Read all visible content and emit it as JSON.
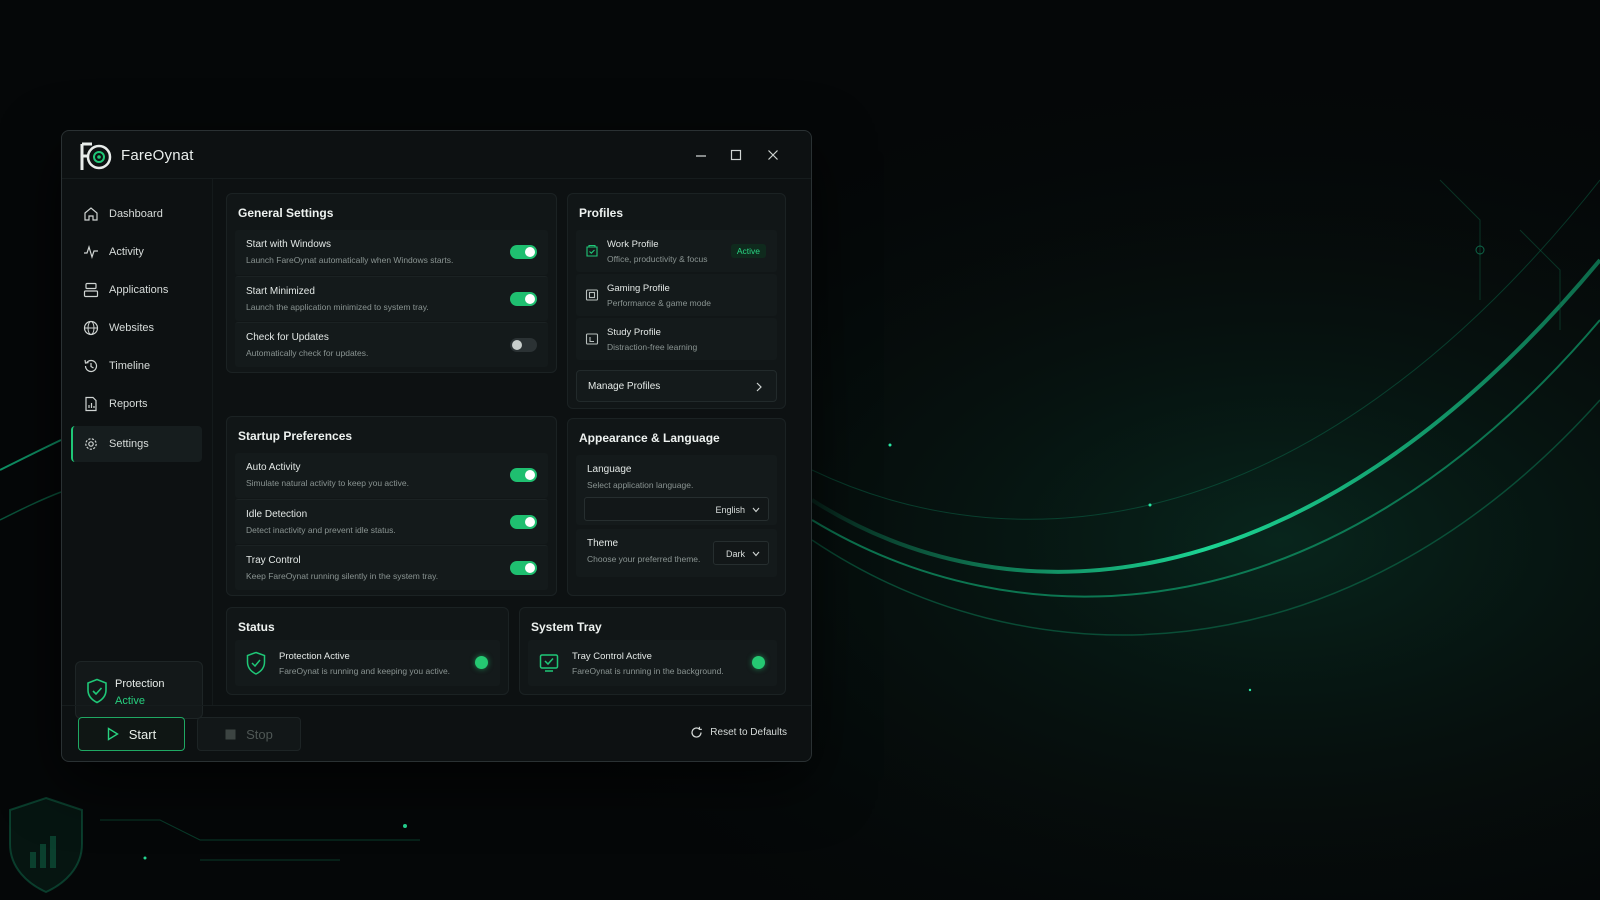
{
  "app": {
    "title": "FareOynat",
    "accent_color": "#1fc777",
    "window_controls": [
      "minimize-icon",
      "maximize-icon",
      "close-icon"
    ]
  },
  "sidebar": {
    "items": [
      {
        "label": "Dashboard",
        "icon": "home-icon"
      },
      {
        "label": "Activity",
        "icon": "pulse-icon"
      },
      {
        "label": "Applications",
        "icon": "applications-icon"
      },
      {
        "label": "Websites",
        "icon": "globe-icon"
      },
      {
        "label": "Timeline",
        "icon": "history-icon"
      },
      {
        "label": "Reports",
        "icon": "reports-icon"
      },
      {
        "label": "Settings",
        "icon": "gear-icon",
        "active": true
      }
    ],
    "protection": {
      "title": "Protection",
      "status": "Active"
    }
  },
  "general": {
    "title": "General Settings",
    "items": [
      {
        "label": "Start with Windows",
        "desc": "Launch FareOynat automatically when Windows starts.",
        "on": true
      },
      {
        "label": "Start Minimized",
        "desc": "Launch the application minimized to system tray.",
        "on": true
      },
      {
        "label": "Check for Updates",
        "desc": "Automatically check for updates.",
        "on": false
      }
    ]
  },
  "profiles": {
    "title": "Profiles",
    "items": [
      {
        "label": "Work Profile",
        "desc": "Office, productivity & focus",
        "badge": "Active",
        "icon": "work-profile-icon"
      },
      {
        "label": "Gaming Profile",
        "desc": "Performance & game mode",
        "icon": "gaming-profile-icon"
      },
      {
        "label": "Study Profile",
        "desc": "Distraction-free learning",
        "icon": "study-profile-icon"
      }
    ],
    "manage_label": "Manage Profiles"
  },
  "startup": {
    "title": "Startup Preferences",
    "items": [
      {
        "label": "Auto Activity",
        "desc": "Simulate natural activity to keep you active.",
        "on": true
      },
      {
        "label": "Idle Detection",
        "desc": "Detect inactivity and prevent idle status.",
        "on": true
      },
      {
        "label": "Tray Control",
        "desc": "Keep FareOynat running silently in the system tray.",
        "on": true
      }
    ]
  },
  "appearance": {
    "title": "Appearance & Language",
    "language": {
      "label": "Language",
      "desc": "Select application language.",
      "value": "English"
    },
    "theme": {
      "label": "Theme",
      "desc": "Choose your preferred theme.",
      "value": "Dark"
    }
  },
  "status": {
    "title": "Status",
    "label": "Protection Active",
    "desc": "FareOynat is running and keeping you active.",
    "indicator_color": "#25c972"
  },
  "tray": {
    "title": "System Tray",
    "label": "Tray Control Active",
    "desc": "FareOynat is running in the background.",
    "indicator_color": "#25c972"
  },
  "footer": {
    "start_label": "Start",
    "stop_label": "Stop",
    "reset_label": "Reset to Defaults"
  }
}
